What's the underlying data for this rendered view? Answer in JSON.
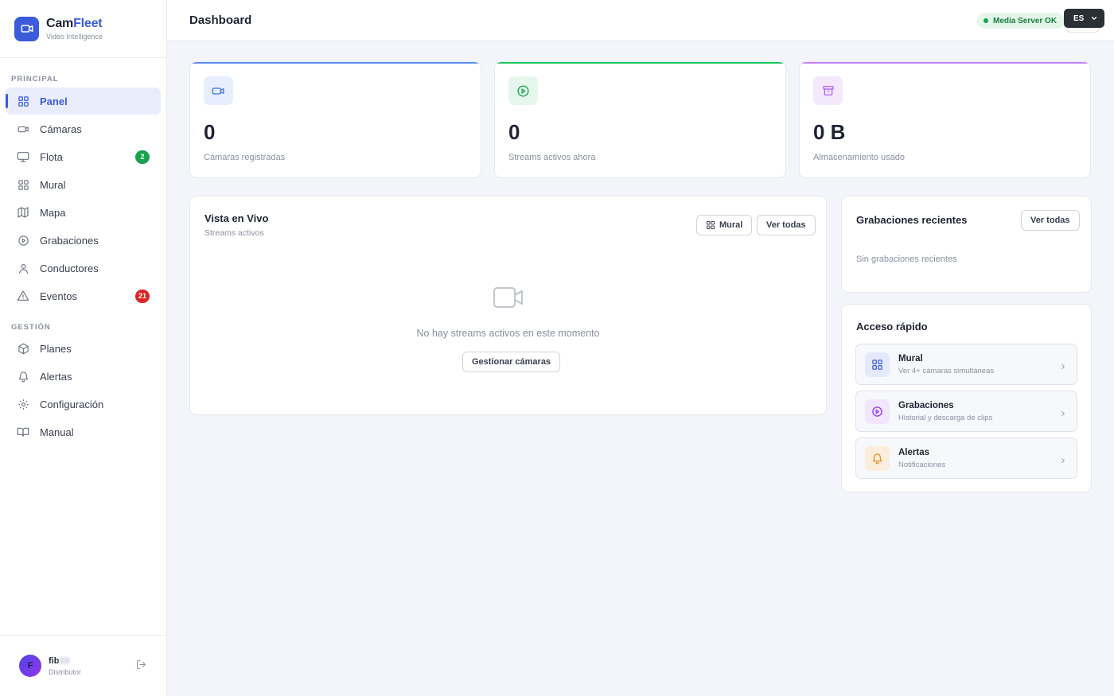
{
  "brand": {
    "name_part1": "Cam",
    "name_part2": "Fleet",
    "subtitle": "Video Intelligence"
  },
  "sidebar": {
    "section_principal": "PRINCIPAL",
    "section_gestion": "GESTIÓN",
    "principal_items": [
      {
        "label": "Panel",
        "icon": "grid-icon",
        "active": true
      },
      {
        "label": "Cámaras",
        "icon": "video-camera-icon"
      },
      {
        "label": "Flota",
        "icon": "monitor-icon",
        "badge": "2",
        "badge_color": "#16a34a"
      },
      {
        "label": "Mural",
        "icon": "grid-icon"
      },
      {
        "label": "Mapa",
        "icon": "map-icon"
      },
      {
        "label": "Grabaciones",
        "icon": "play-circle-icon"
      },
      {
        "label": "Conductores",
        "icon": "user-icon"
      },
      {
        "label": "Eventos",
        "icon": "warning-icon",
        "badge": "21",
        "badge_color": "#dc2626"
      }
    ],
    "gestion_items": [
      {
        "label": "Planes",
        "icon": "box-icon"
      },
      {
        "label": "Alertas",
        "icon": "bell-icon"
      },
      {
        "label": "Configuración",
        "icon": "gear-icon"
      },
      {
        "label": "Manual",
        "icon": "book-icon"
      }
    ]
  },
  "user": {
    "initial": "F",
    "name": "fib",
    "role": "Distributor"
  },
  "header": {
    "title": "Dashboard",
    "server_status": "Media Server OK",
    "language": "ES"
  },
  "stats": [
    {
      "value": "0",
      "label": "Cámaras registradas",
      "icon": "video-camera-icon",
      "accent": "#5b8def"
    },
    {
      "value": "0",
      "label": "Streams activos ahora",
      "icon": "play-circle-icon",
      "accent": "#22c55e"
    },
    {
      "value": "0 B",
      "label": "Almacenamiento usado",
      "icon": "archive-icon",
      "accent": "#c084fc"
    }
  ],
  "live": {
    "title": "Vista en Vivo",
    "subtitle": "Streams activos",
    "mural_button": "Mural",
    "view_all_button": "Ver todas",
    "empty_message": "No hay streams activos en este momento",
    "manage_button": "Gestionar cámaras"
  },
  "recent": {
    "title": "Grabaciones recientes",
    "view_all_button": "Ver todas",
    "empty_message": "Sin grabaciones recientes"
  },
  "quick_access": {
    "title": "Acceso rápido",
    "items": [
      {
        "title": "Mural",
        "subtitle": "Ver 4+ cámaras simultáneas",
        "icon": "grid-icon"
      },
      {
        "title": "Grabaciones",
        "subtitle": "Historial y descarga de clips",
        "icon": "play-circle-icon"
      },
      {
        "title": "Alertas",
        "subtitle": "Notificaciones",
        "icon": "bell-icon"
      }
    ]
  },
  "colors": {
    "primary": "#3b5bdb",
    "success": "#16a34a",
    "danger": "#dc2626",
    "background": "#f3f5fb"
  }
}
